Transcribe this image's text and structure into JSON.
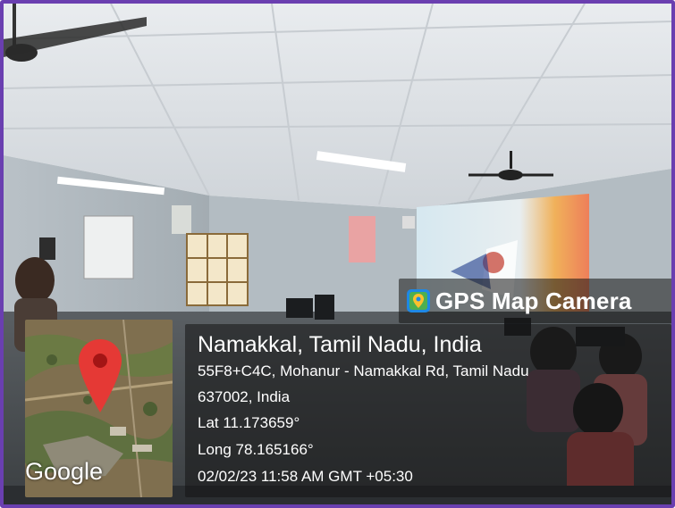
{
  "app": {
    "name": "GPS Map Camera"
  },
  "map": {
    "attribution": "Google",
    "pin_icon": "location-pin-icon"
  },
  "location": {
    "title": "Namakkal, Tamil Nadu, India",
    "address_line1": "55F8+C4C, Mohanur - Namakkal Rd, Tamil Nadu",
    "address_line2": "637002, India",
    "latitude": "Lat 11.173659°",
    "longitude": "Long 78.165166°",
    "timestamp": "02/02/23 11:58 AM GMT +05:30"
  },
  "colors": {
    "frame": "#6a3fb0",
    "pin": "#e53935",
    "overlay": "rgba(20,20,20,0.55)"
  }
}
